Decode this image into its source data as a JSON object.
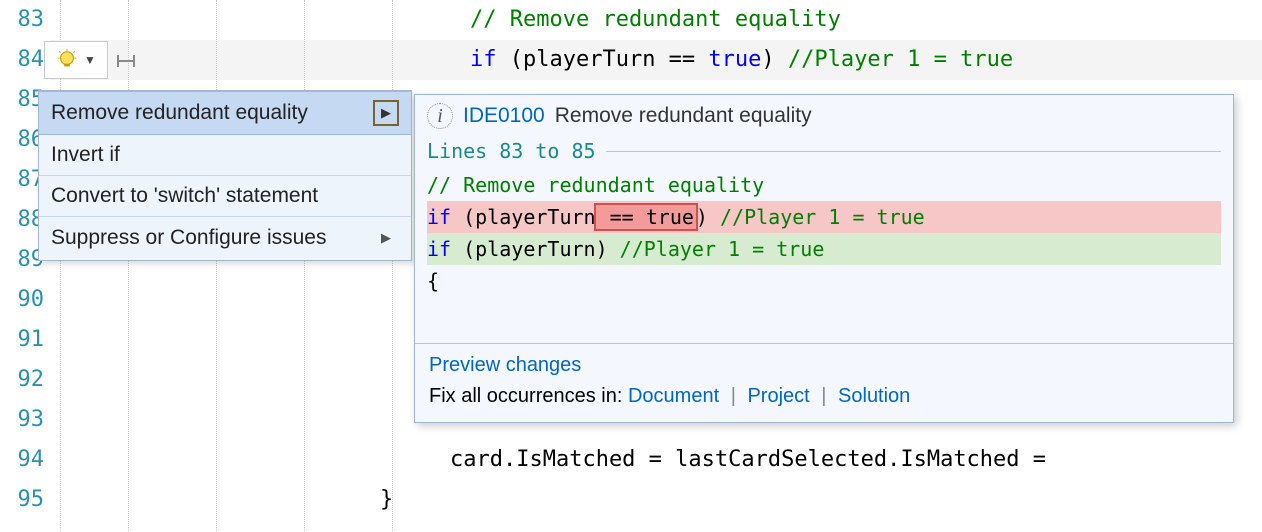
{
  "gutter": {
    "start": 83,
    "end": 95
  },
  "code": {
    "line83_comment": "// Remove redundant equality",
    "line84_if": "if",
    "line84_open": " (playerTurn == ",
    "line84_true": "true",
    "line84_close": ") ",
    "line84_comment": "//Player 1 = true",
    "line94_text": "card.IsMatched = lastCardSelected.IsMatched =",
    "line95_text": "}"
  },
  "quick_actions": {
    "items": [
      {
        "label": "Remove redundant equality",
        "selected": true,
        "has_submenu": true,
        "boxed_arrow": true
      },
      {
        "label": "Invert if",
        "selected": false,
        "has_submenu": false
      },
      {
        "label": "Convert to 'switch' statement",
        "selected": false,
        "has_submenu": false
      },
      {
        "label": "Suppress or Configure issues",
        "selected": false,
        "has_submenu": true,
        "boxed_arrow": false
      }
    ]
  },
  "preview": {
    "rule_id": "IDE0100",
    "rule_title": "Remove redundant equality",
    "lines_label": "Lines 83 to 85",
    "diff_comment": "// Remove redundant equality",
    "diff_del_before": "if (playerTurn",
    "diff_del_box": " == true",
    "diff_del_after": ") //Player 1 = true",
    "diff_add_if": "if",
    "diff_add_mid": " (playerTurn) ",
    "diff_add_comment": "//Player 1 = true",
    "diff_brace": "{",
    "preview_changes": "Preview changes",
    "fix_label": "Fix all occurrences in: ",
    "scope_document": "Document",
    "scope_project": "Project",
    "scope_solution": "Solution"
  }
}
